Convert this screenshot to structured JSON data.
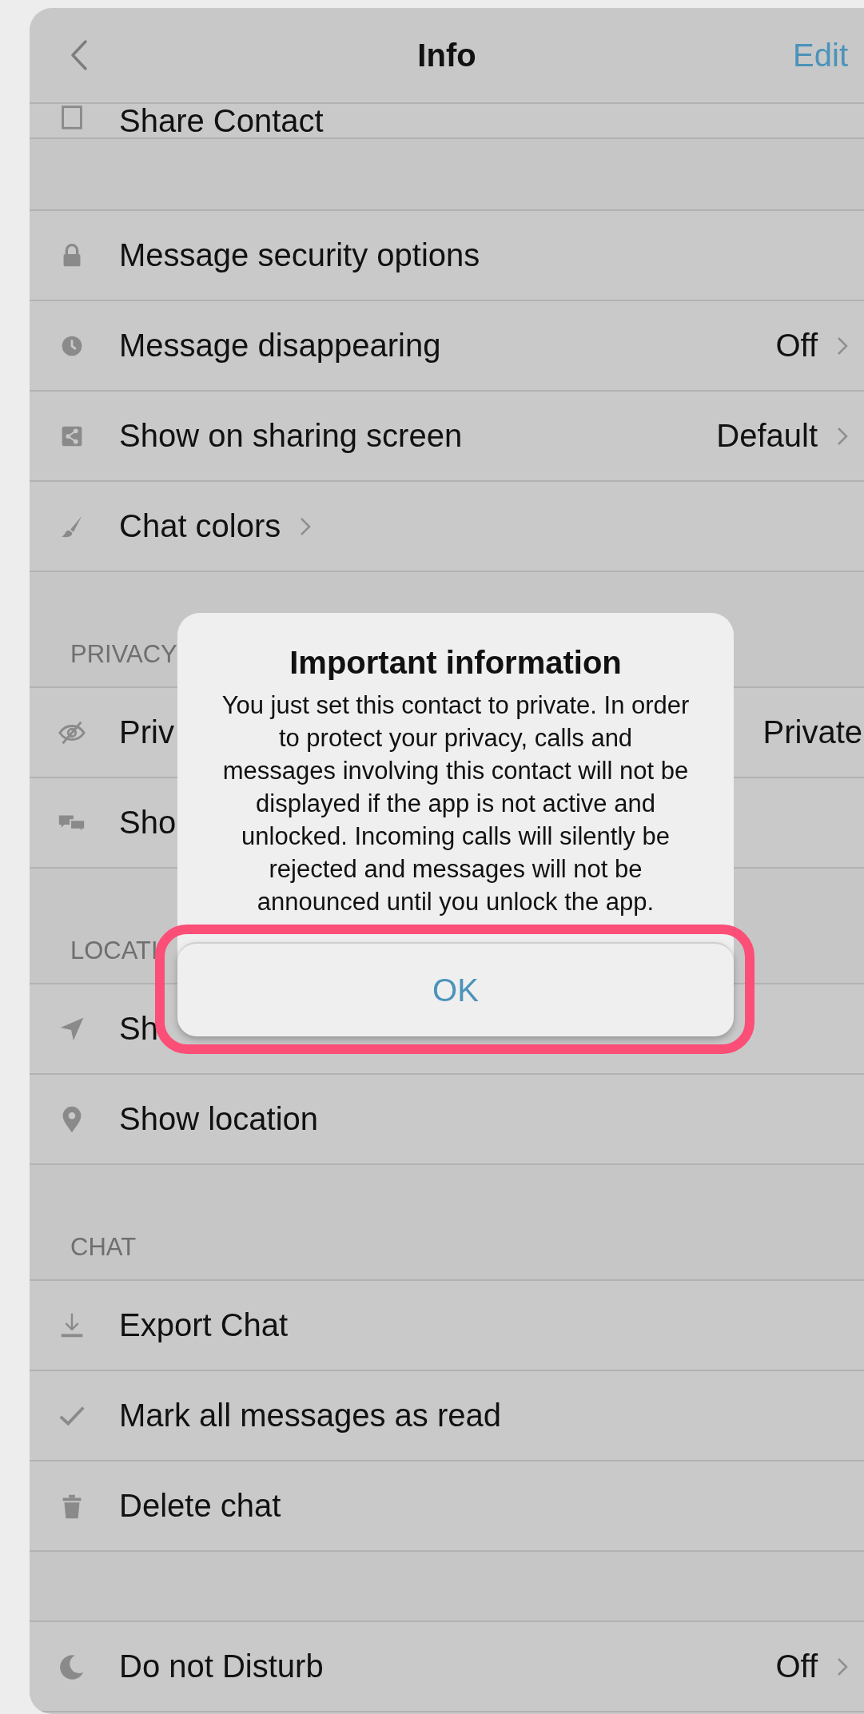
{
  "nav": {
    "title": "Info",
    "action": "Edit"
  },
  "sections": [
    {
      "rows": [
        {
          "label": "Share Contact"
        }
      ]
    },
    {
      "rows": [
        {
          "label": "Message security options"
        },
        {
          "label": "Message disappearing",
          "value": "Off",
          "chevron": true
        },
        {
          "label": "Show on sharing screen",
          "value": "Default",
          "chevron": true
        },
        {
          "label": "Chat colors",
          "chevron": true
        }
      ]
    },
    {
      "header": "PRIVACY",
      "rows": [
        {
          "label": "Priv",
          "value": "Private"
        },
        {
          "label": "Sho"
        }
      ]
    },
    {
      "header": "LOCATI",
      "rows": [
        {
          "label": "Sh"
        },
        {
          "label": "Show location"
        }
      ]
    },
    {
      "header": "CHAT",
      "rows": [
        {
          "label": "Export Chat"
        },
        {
          "label": "Mark all messages as read"
        },
        {
          "label": "Delete chat"
        }
      ]
    },
    {
      "rows": [
        {
          "label": "Do not Disturb",
          "value": "Off",
          "chevron": true
        }
      ]
    }
  ],
  "dialog": {
    "title": "Important information",
    "message": "You just set this contact to private. In order to protect your privacy, calls and messages involving this contact will not be displayed if the app is not active and unlocked. Incoming calls will silently be rejected and messages will not be announced until you unlock the app.",
    "button": "OK",
    "highlighted": true
  }
}
